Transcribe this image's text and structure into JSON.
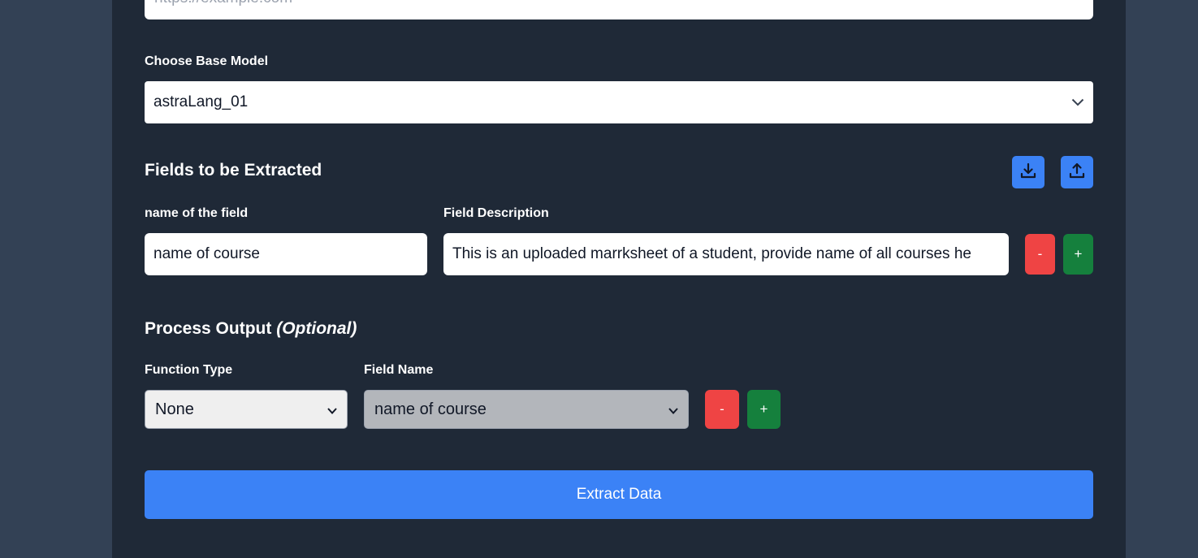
{
  "url_field": {
    "placeholder": "https://example.com"
  },
  "base_model": {
    "label": "Choose Base Model",
    "selected": "astraLang_01"
  },
  "fields_section": {
    "title": "Fields to be Extracted",
    "name_label": "name of the field",
    "desc_label": "Field Description",
    "rows": [
      {
        "name": "name of course",
        "description": "This is an uploaded marrksheet of a student, provide name of all courses he"
      }
    ],
    "remove_label": "-",
    "add_label": "+",
    "icons": {
      "download": "download-icon",
      "upload": "upload-icon"
    }
  },
  "process_output": {
    "title": "Process Output",
    "title_suffix": "(Optional)",
    "function_type_label": "Function Type",
    "field_name_label": "Field Name",
    "function_type_selected": "None",
    "field_name_selected": "name of course",
    "remove_label": "-",
    "add_label": "+"
  },
  "extract_button": {
    "label": "Extract Data"
  },
  "colors": {
    "page_bg": "#334155",
    "panel_bg": "#1f2937",
    "accent": "#3b82f6",
    "danger": "#ef4444",
    "success": "#15803d"
  }
}
